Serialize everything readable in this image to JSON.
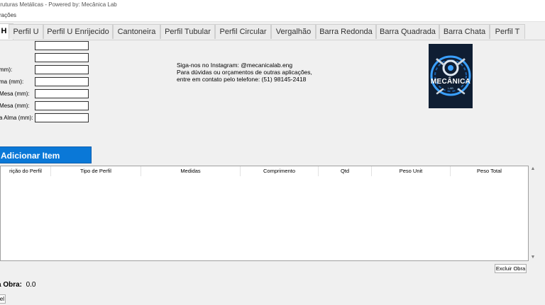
{
  "window": {
    "title": "truturas Metálicas - Powered by: Mecânica Lab"
  },
  "menu": {
    "label": "rações"
  },
  "tabs": [
    {
      "label": "H",
      "active": true
    },
    {
      "label": "Perfil U"
    },
    {
      "label": "Perfil U Enrijecido"
    },
    {
      "label": "Cantoneira"
    },
    {
      "label": "Perfil Tubular"
    },
    {
      "label": "Perfil Circular"
    },
    {
      "label": "Vergalhão"
    },
    {
      "label": "Barra Redonda"
    },
    {
      "label": "Barra Quadrada"
    },
    {
      "label": "Barra Chata"
    },
    {
      "label": "Perfil T"
    }
  ],
  "form": {
    "fields": [
      {
        "label": "",
        "value": ""
      },
      {
        "label": "",
        "value": ""
      },
      {
        "label": "mm):",
        "value": ""
      },
      {
        "label": "ma (mm):",
        "value": ""
      },
      {
        "label": "Mesa (mm):",
        "value": ""
      },
      {
        "label": "Mesa (mm):",
        "value": ""
      },
      {
        "label": "a Alma (mm):",
        "value": ""
      }
    ]
  },
  "contact": {
    "line1": "Siga-nos no Instagram: @mecanicalab.eng",
    "line2": "Para dúvidas ou orçamentos de outras aplicações,",
    "line3": "entre em contato pelo telefone: (51) 98145-2418"
  },
  "logo": {
    "text": "MECÂNICA",
    "sub": "LAB",
    "icon": "gear-wrench-icon",
    "bg": "#0f1e33",
    "accent": "#3aa0ff"
  },
  "actions": {
    "add_label": "Adicionar Item",
    "delete_label": "Excluir Obra",
    "bottom_label": "el"
  },
  "table": {
    "columns": [
      "rição do Perfil",
      "Tipo de Perfil",
      "Medidas",
      "Comprimento",
      "Qtd",
      "Peso Unit",
      "Peso Total"
    ],
    "rows": []
  },
  "total": {
    "label": "a Obra:",
    "value": "0.0"
  },
  "colors": {
    "accent": "#0a78d7"
  }
}
